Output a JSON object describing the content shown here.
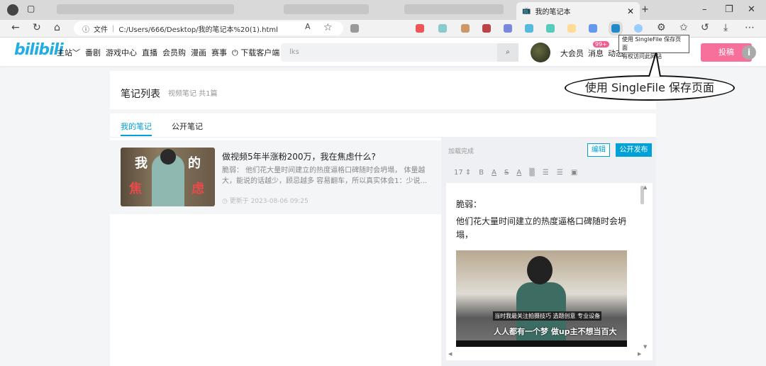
{
  "browser": {
    "active_tab": "我的笔记本",
    "address_prefix": "文件",
    "url": "C:/Users/666/Desktop/我的笔记本%20(1).html",
    "tooltip_line1": "使用 SingleFile 保存页面",
    "tooltip_line2": "有权访问此网站"
  },
  "annotation": "使用 SingleFile 保存页面",
  "header": {
    "logo": "bilibili",
    "nav": [
      "主站﹀",
      "番剧",
      "游戏中心",
      "直播",
      "会员购",
      "漫画",
      "赛事",
      "⏻ 下载客户端"
    ],
    "search_value": "lks",
    "right_nav": [
      "大会员",
      "消息",
      "动态"
    ],
    "badge": "99+",
    "upload": "投稿"
  },
  "page": {
    "title": "笔记列表",
    "subtitle": "视频笔记 共1篇",
    "tabs": [
      "我的笔记",
      "公开笔记"
    ]
  },
  "note": {
    "thumb_text": [
      "我",
      "的",
      "焦",
      "虑"
    ],
    "title": "做视频5年半涨粉200万，我在焦虑什么?",
    "desc": "脆弱： 他们花大量时间建立的热度逼格口碑随时会坍塌， 体量越大，能说的话越少，顾忌越多 容易翻车，所以真实体会1：少说...",
    "time": "◷ 更新于 2023-08-06 09:25"
  },
  "editor": {
    "status": "加载完成",
    "edit": "编辑",
    "publish": "公开发布",
    "font_size": "17 ⇕",
    "tools": [
      "B",
      "A",
      "S",
      "A",
      "▒",
      "☰",
      "☰",
      "▣"
    ],
    "p1": "脆弱：",
    "p2": "他们花大量时间建立的热度逼格口碑随时会坍塌，",
    "sub1": "当时我最关注拍摄技巧 选题创意 专业设备",
    "sub2": "人人都有一个梦 做up主不想当百大"
  }
}
